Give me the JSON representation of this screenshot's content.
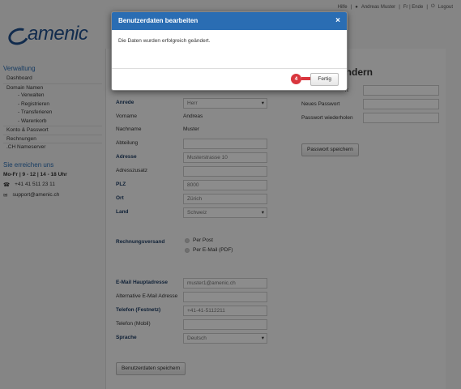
{
  "topbar": {
    "items": [
      "Hilfe",
      "Andreas Muster",
      "Fr | Ende",
      "Logout"
    ]
  },
  "logo": {
    "word": "amenic"
  },
  "sidebar": {
    "heading": "Verwaltung",
    "items": [
      {
        "label": "Dashboard",
        "sub": false
      },
      {
        "label": "Domain Namen",
        "sub": false
      },
      {
        "label": "- Verwalten",
        "sub": true
      },
      {
        "label": "- Registrieren",
        "sub": true
      },
      {
        "label": "- Transferieren",
        "sub": true
      },
      {
        "label": "- Warenkorb",
        "sub": true
      },
      {
        "label": "Konto & Passwort",
        "sub": false
      },
      {
        "label": "Rechnungen",
        "sub": false
      },
      {
        "label": ".CH Nameserver",
        "sub": false
      }
    ],
    "contact_heading": "Sie erreichen uns",
    "hours": "Mo-Fr | 9 - 12 | 14 - 18 Uhr",
    "phone": "+41 41 511 23 11",
    "email": "support@amenic.ch"
  },
  "form": {
    "anrede_label": "Anrede",
    "anrede_value": "Herr",
    "vorname_label": "Vorname",
    "vorname_value": "Andreas",
    "nachname_label": "Nachname",
    "nachname_value": "Muster",
    "abteilung_label": "Abteilung",
    "adresse_label": "Adresse",
    "adresse_value": "Musterstrasse 10",
    "adresszusatz_label": "Adresszusatz",
    "plz_label": "PLZ",
    "plz_value": "8000",
    "ort_label": "Ort",
    "ort_value": "Zürich",
    "land_label": "Land",
    "land_value": "Schweiz",
    "rechnungsversand_label": "Rechnungsversand",
    "radio_post": "Per Post",
    "radio_email": "Per E-Mail (PDF)",
    "email_label": "E-Mail Hauptadresse",
    "email_value": "muster1@amenic.ch",
    "alt_email_label": "Alternative E-Mail Adresse",
    "tel_label": "Telefon (Festnetz)",
    "tel_value": "+41-41-5112211",
    "mobil_label": "Telefon (Mobil)",
    "sprache_label": "Sprache",
    "sprache_value": "Deutsch",
    "save_button": "Benutzerdaten speichern"
  },
  "password": {
    "title_partial": "ändern",
    "current_label": "rt",
    "new_label": "Neues Passwort",
    "repeat_label": "Passwort wiederholen",
    "save_button": "Passwort speichern"
  },
  "modal": {
    "title": "Benutzerdaten bearbeiten",
    "message": "Die Daten wurden erfolgreich geändert.",
    "close": "×",
    "button": "Fertig",
    "step": "4"
  },
  "colors": {
    "accent": "#2a6db3",
    "badge": "#d9363e"
  }
}
